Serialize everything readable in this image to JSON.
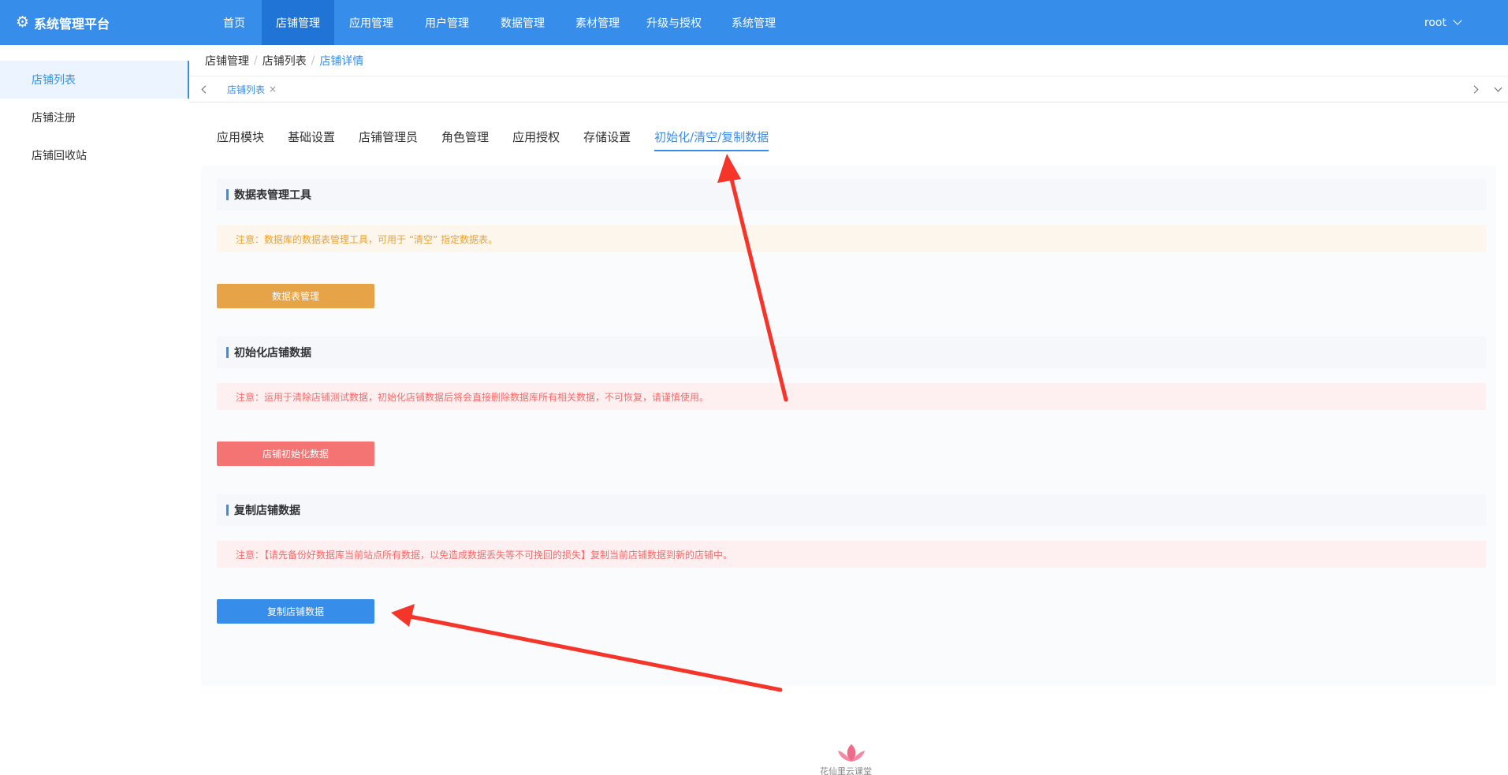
{
  "header": {
    "brand": "系统管理平台",
    "nav": [
      {
        "label": "首页",
        "active": false
      },
      {
        "label": "店铺管理",
        "active": true
      },
      {
        "label": "应用管理",
        "active": false
      },
      {
        "label": "用户管理",
        "active": false
      },
      {
        "label": "数据管理",
        "active": false
      },
      {
        "label": "素材管理",
        "active": false
      },
      {
        "label": "升级与授权",
        "active": false
      },
      {
        "label": "系统管理",
        "active": false
      }
    ],
    "user": "root"
  },
  "sidebar": {
    "items": [
      {
        "label": "店铺列表",
        "active": true
      },
      {
        "label": "店铺注册",
        "active": false
      },
      {
        "label": "店铺回收站",
        "active": false
      }
    ]
  },
  "breadcrumb": [
    "店铺管理",
    "店铺列表",
    "店铺详情"
  ],
  "tags": [
    {
      "label": "店铺列表",
      "close": "×"
    }
  ],
  "tabs": [
    {
      "label": "应用模块",
      "active": false
    },
    {
      "label": "基础设置",
      "active": false
    },
    {
      "label": "店铺管理员",
      "active": false
    },
    {
      "label": "角色管理",
      "active": false
    },
    {
      "label": "应用授权",
      "active": false
    },
    {
      "label": "存储设置",
      "active": false
    },
    {
      "label": "初始化/清空/复制数据",
      "active": true
    }
  ],
  "sections": {
    "table_tool": {
      "title": "数据表管理工具",
      "notice": "注意：数据库的数据表管理工具，可用于 “清空” 指定数据表。",
      "button": "数据表管理"
    },
    "init": {
      "title": "初始化店铺数据",
      "notice": "注意：运用于清除店铺测试数据，初始化店铺数据后将会直接删除数据库所有相关数据，不可恢复，请谨慎使用。",
      "button": "店铺初始化数据"
    },
    "copy": {
      "title": "复制店铺数据",
      "notice": "注意：【请先备份好数据库当前站点所有数据，以免造成数据丢失等不可挽回的损失】复制当前店铺数据到新的店铺中。",
      "button": "复制店铺数据"
    }
  },
  "footer": {
    "watermark": "花仙里云课堂"
  },
  "colors": {
    "primary": "#378eea",
    "warning_bg": "#fdf6ec",
    "warning_text": "#e6a23c",
    "danger_bg": "#fef0f0",
    "danger_text": "#f56c6c",
    "btn_orange": "#e6a348",
    "btn_red": "#f47474",
    "annotation_arrow": "#f5352a"
  },
  "icons": {
    "brand": "gear-icon",
    "user_menu": "chevron-down-icon",
    "tags_left": "chevron-left-icon",
    "tags_right": "chevron-right-icon",
    "tags_menu": "chevron-down-icon"
  }
}
